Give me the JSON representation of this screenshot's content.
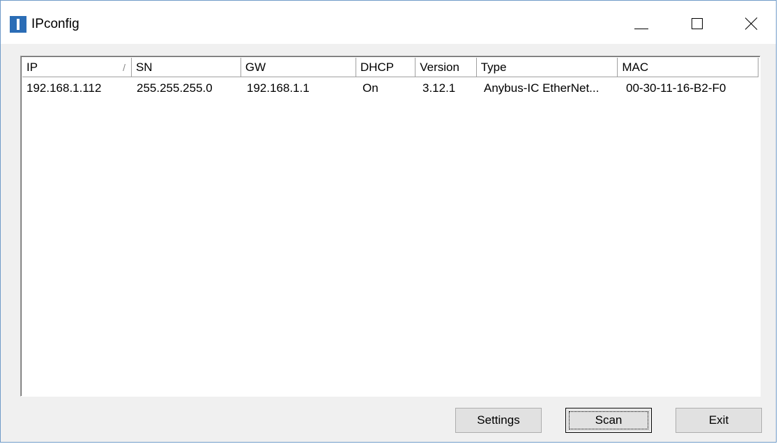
{
  "window": {
    "title": "IPconfig",
    "accent": "#2b6db6"
  },
  "icons": {
    "app": "app-logo-icon",
    "minimize": "minimize-icon",
    "maximize": "maximize-icon",
    "close": "close-icon"
  },
  "table": {
    "columns": [
      {
        "key": "ip",
        "label": "IP"
      },
      {
        "key": "sn",
        "label": "SN"
      },
      {
        "key": "gw",
        "label": "GW"
      },
      {
        "key": "dhcp",
        "label": "DHCP"
      },
      {
        "key": "version",
        "label": "Version"
      },
      {
        "key": "type",
        "label": "Type"
      },
      {
        "key": "mac",
        "label": "MAC"
      }
    ],
    "sort_indicator": "/",
    "rows": [
      {
        "ip": "192.168.1.112",
        "sn": "255.255.255.0",
        "gw": "192.168.1.1",
        "dhcp": "On",
        "version": "3.12.1",
        "type": "Anybus-IC EtherNet...",
        "mac": "00-30-11-16-B2-F0"
      }
    ]
  },
  "buttons": {
    "settings": "Settings",
    "scan": "Scan",
    "exit": "Exit"
  }
}
